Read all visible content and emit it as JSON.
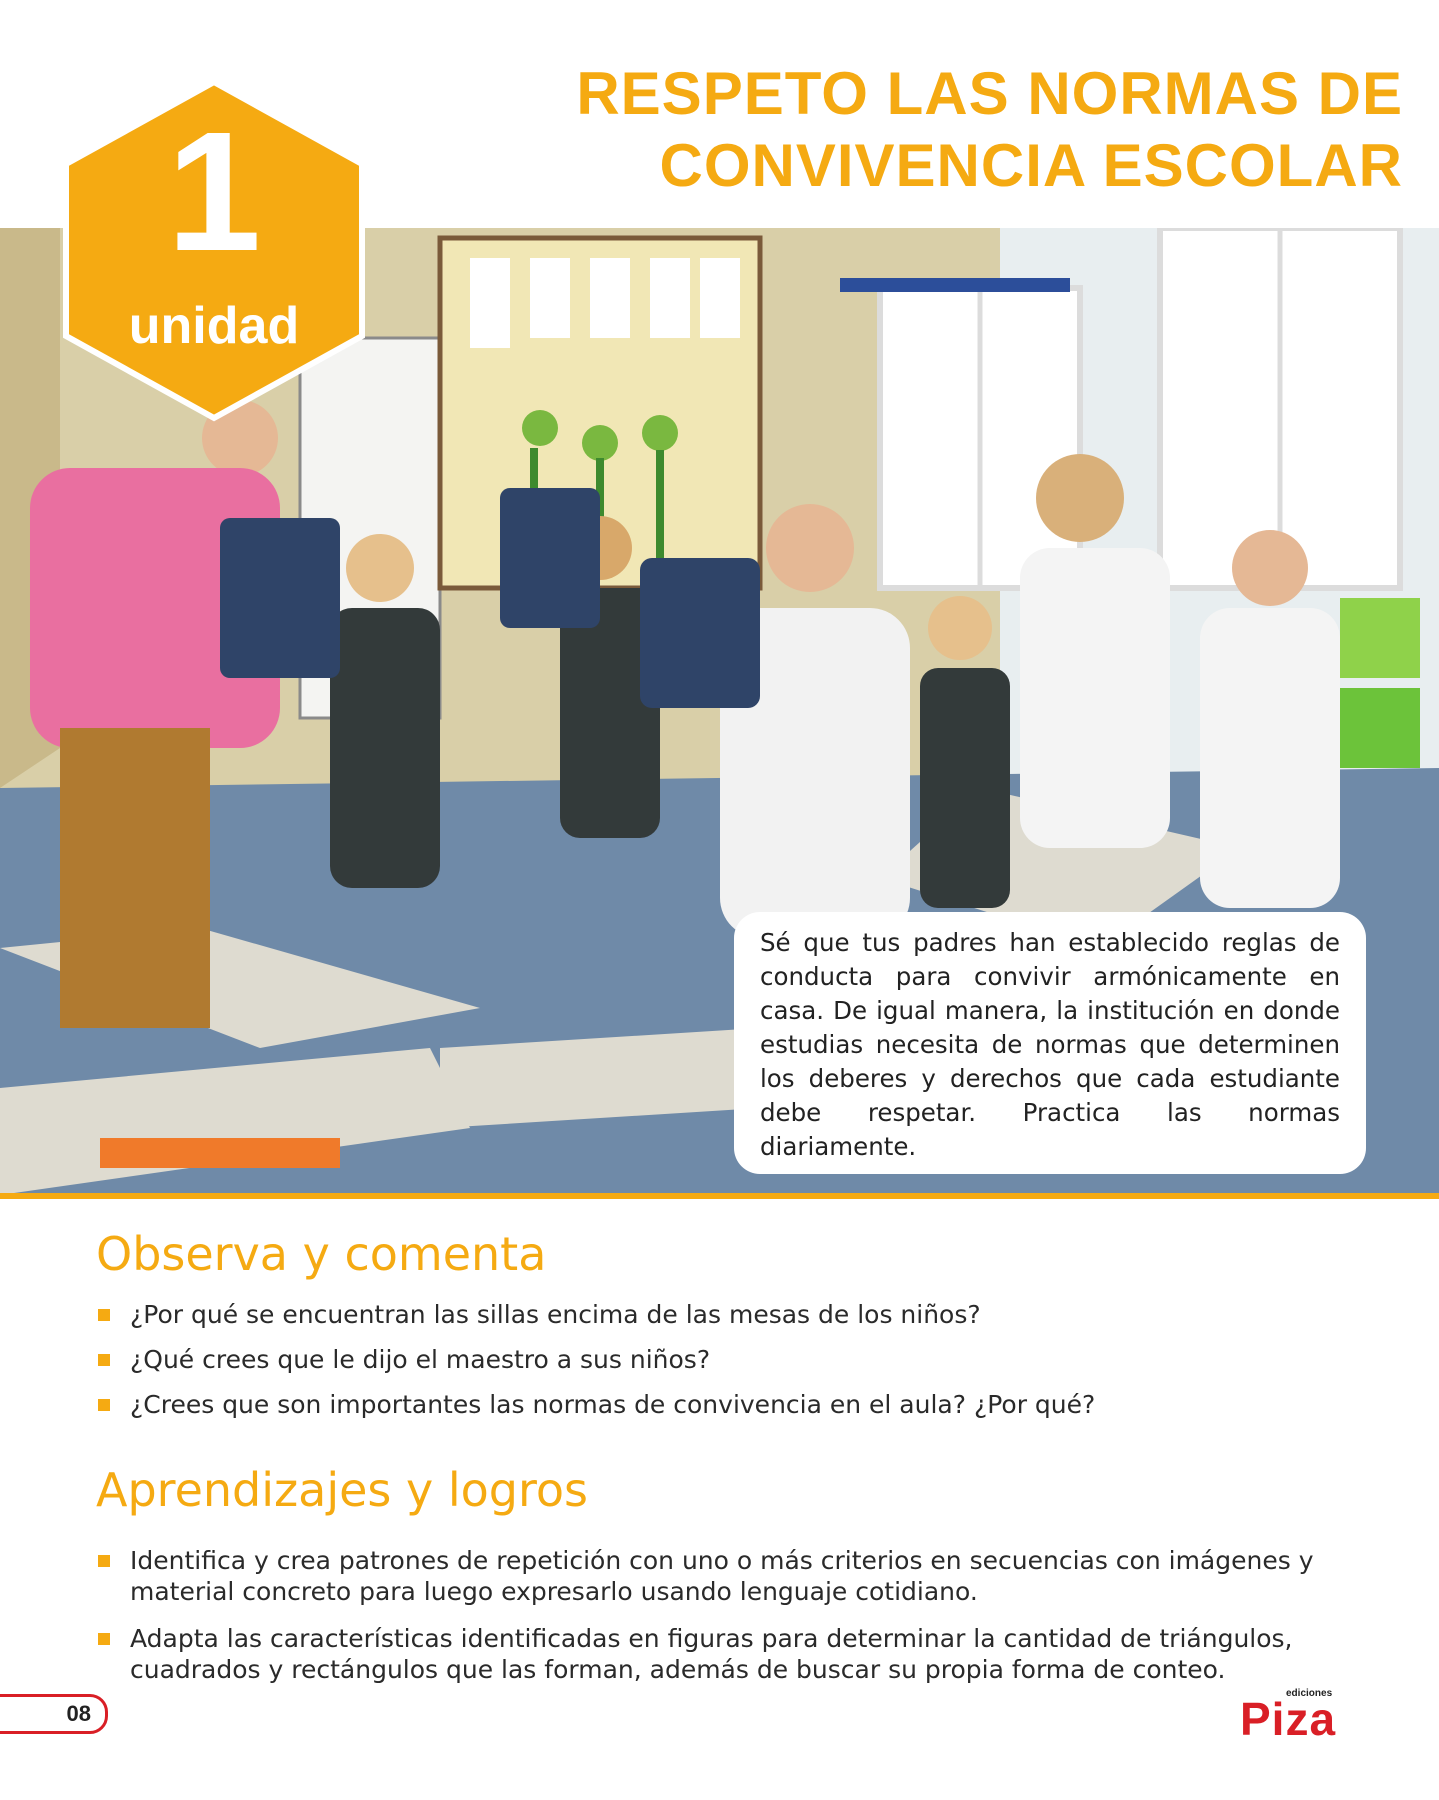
{
  "header": {
    "title_line1": "RESPETO LAS NORMAS DE",
    "title_line2": "CONVIVENCIA ESCOLAR"
  },
  "badge": {
    "number": "1",
    "label": "unidad"
  },
  "intro": {
    "text": "Sé que tus padres han establecido reglas de conducta para convivir armónicamente en casa. De igual manera, la institución en donde estudias necesita de normas que determinen los deberes y derechos que cada estudiante debe respetar. Practica las normas diariamente."
  },
  "observa": {
    "heading": "Observa y comenta",
    "items": [
      "¿Por qué se encuentran las sillas encima de las mesas de los niños?",
      "¿Qué crees que le dijo el maestro a sus niños?",
      "¿Crees que son importantes las normas de convivencia en el aula? ¿Por qué?"
    ]
  },
  "aprendizajes": {
    "heading": "Aprendizajes y logros",
    "items": [
      "Identifica y crea patrones de repetición con uno o más criterios en secuencias con imágenes y material concreto para luego expresarlo usando lenguaje cotidiano.",
      "Adapta las características identificadas en figuras para determinar la cantidad de triángulos, cuadrados y rectángulos que las forman, además de buscar su propia forma de conteo."
    ]
  },
  "footer": {
    "page_number": "08",
    "logo_small": "ediciones",
    "logo_main": "Piza"
  },
  "colors": {
    "accent": "#f5aa12",
    "brand_red": "#d91f26"
  }
}
